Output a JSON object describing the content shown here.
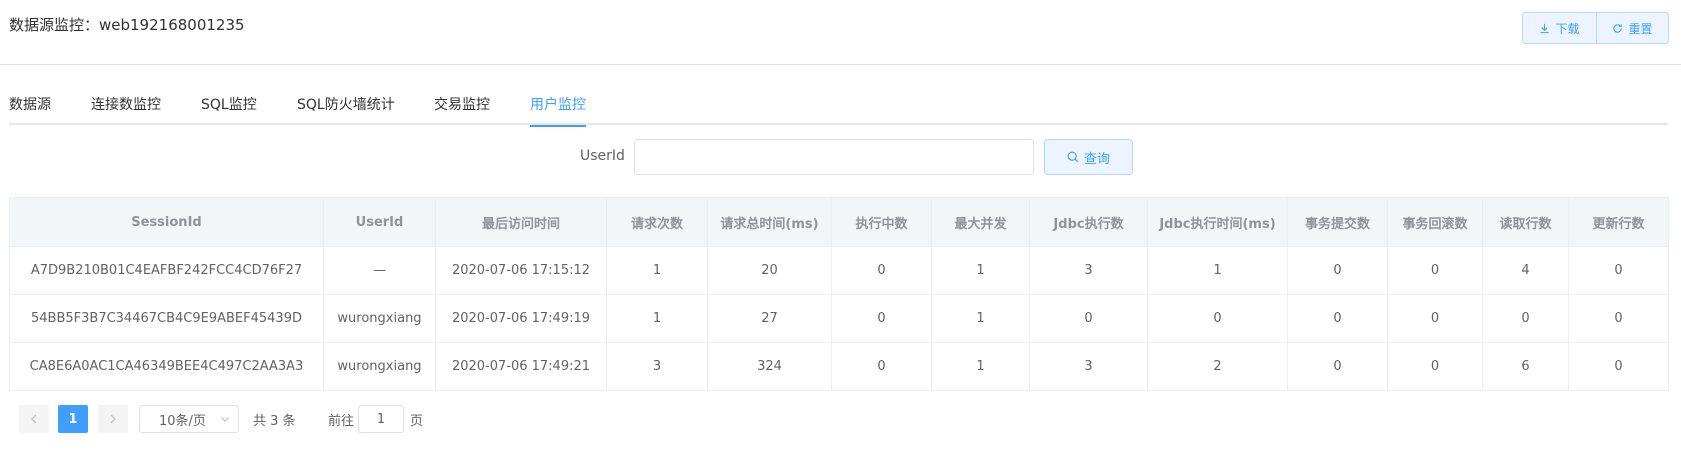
{
  "header": {
    "title": "数据源监控：web192168001235",
    "download_label": "下载",
    "reset_label": "重置"
  },
  "tabs": [
    {
      "label": "数据源"
    },
    {
      "label": "连接数监控"
    },
    {
      "label": "SQL监控"
    },
    {
      "label": "SQL防火墙统计"
    },
    {
      "label": "交易监控"
    },
    {
      "label": "用户监控"
    }
  ],
  "active_tab": "用户监控",
  "search": {
    "label": "UserId",
    "value": "",
    "placeholder": "",
    "button_label": "查询"
  },
  "table": {
    "columns": [
      "SessionId",
      "UserId",
      "最后访问时间",
      "请求次数",
      "请求总时间(ms)",
      "执行中数",
      "最大并发",
      "Jdbc执行数",
      "Jdbc执行时间(ms)",
      "事务提交数",
      "事务回滚数",
      "读取行数",
      "更新行数"
    ],
    "rows": [
      [
        "A7D9B210B01C4EAFBF242FCC4CD76F27",
        "—",
        "2020-07-06 17:15:12",
        "1",
        "20",
        "0",
        "1",
        "3",
        "1",
        "0",
        "0",
        "4",
        "0"
      ],
      [
        "54BB5F3B7C34467CB4C9E9ABEF45439D",
        "wurongxiang",
        "2020-07-06 17:49:19",
        "1",
        "27",
        "0",
        "1",
        "0",
        "0",
        "0",
        "0",
        "0",
        "0"
      ],
      [
        "CA8E6A0AC1CA46349BEE4C497C2AA3A3",
        "wurongxiang",
        "2020-07-06 17:49:21",
        "3",
        "324",
        "0",
        "1",
        "3",
        "2",
        "0",
        "0",
        "6",
        "0"
      ]
    ]
  },
  "pagination": {
    "current_page": "1",
    "page_size_label": "10条/页",
    "total_text": "共 3 条",
    "goto_prefix": "前往",
    "goto_value": "1",
    "goto_suffix": "页"
  },
  "icons": {
    "download": "download-icon",
    "reset": "refresh-icon",
    "search": "search-icon",
    "prev": "chevron-left-icon",
    "next": "chevron-right-icon",
    "dropdown": "chevron-down-icon"
  },
  "colors": {
    "accent": "#409eff",
    "accent_light_bg": "#ecf5ff",
    "accent_border": "#b3d8ff",
    "header_bg": "#f3f6f9",
    "text": "#606266"
  }
}
